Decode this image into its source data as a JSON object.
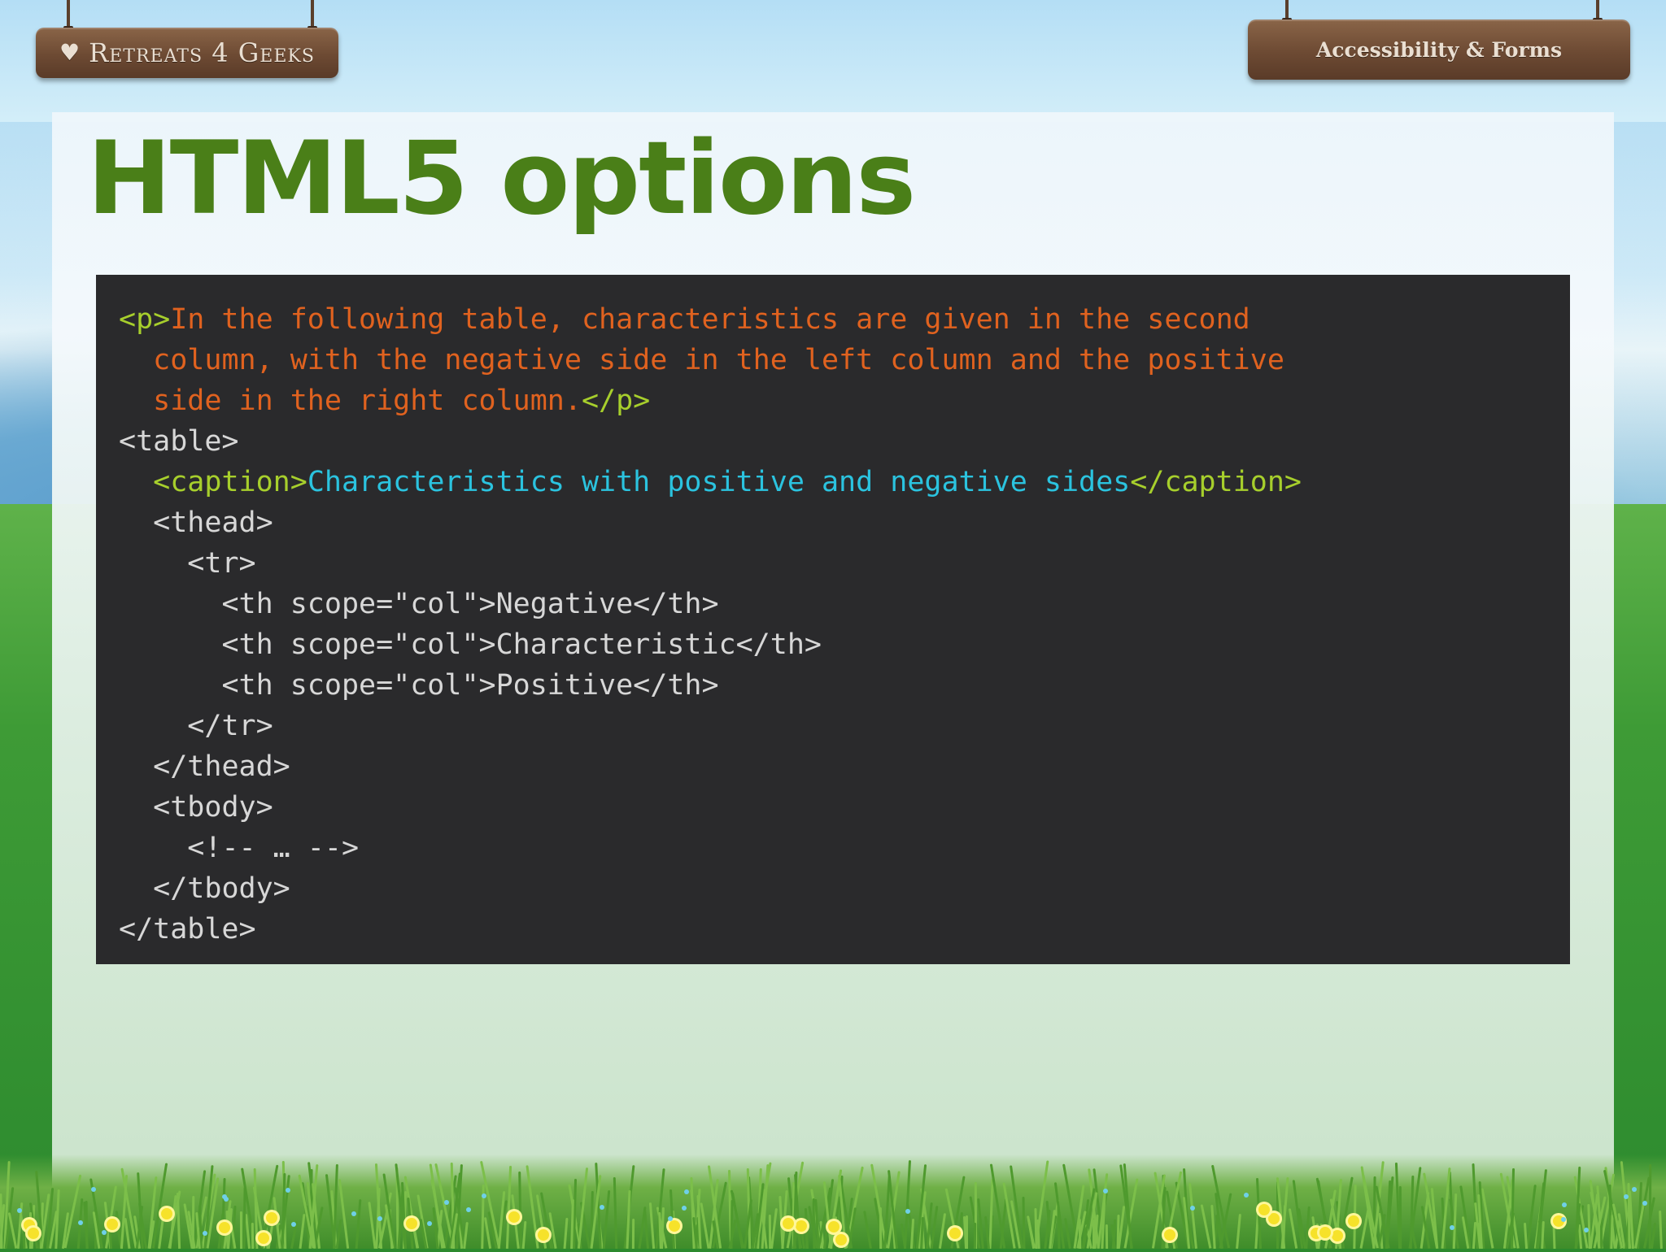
{
  "header": {
    "logo_text": "Retreats 4 Geeks",
    "topic": "Accessibility & Forms"
  },
  "slide": {
    "title": "HTML5 options"
  },
  "code": {
    "p_open": "<p>",
    "p_text_1": "In the following table, characteristics are given in the second",
    "p_text_2": "column, with the negative side in the left column and the positive",
    "p_text_3": "side in the right column.",
    "p_close": "</p>",
    "table_open": "<table>",
    "caption_open": "<caption>",
    "caption_text": "Characteristics with positive and negative sides",
    "caption_close": "</caption>",
    "thead_open": "<thead>",
    "tr_open": "<tr>",
    "th_1_open": "<th scope=\"col\">",
    "th_1_text": "Negative",
    "th_1_close": "</th>",
    "th_2_open": "<th scope=\"col\">",
    "th_2_text": "Characteristic",
    "th_2_close": "</th>",
    "th_3_open": "<th scope=\"col\">",
    "th_3_text": "Positive",
    "th_3_close": "</th>",
    "tr_close": "</tr>",
    "thead_close": "</thead>",
    "tbody_open": "<tbody>",
    "comment": "<!-- … -->",
    "tbody_close": "</tbody>",
    "table_close": "</table>"
  },
  "colors": {
    "title": "#4a7f18",
    "code_bg": "#2a2a2c",
    "tag_green": "#a7cf2c",
    "text_orange": "#e0621f",
    "text_cyan": "#2bc3df",
    "plain": "#d7d7d7",
    "sign_wood": "#6d4a33"
  }
}
